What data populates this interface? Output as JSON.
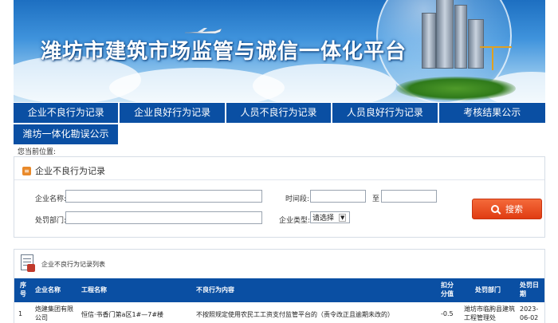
{
  "banner": {
    "title": "潍坊市建筑市场监管与诚信一体化平台"
  },
  "nav": {
    "row1": [
      "企业不良行为记录",
      "企业良好行为记录",
      "人员不良行为记录",
      "人员良好行为记录",
      "考核结果公示"
    ],
    "row2": [
      "潍坊一体化勘误公示"
    ]
  },
  "breadcrumb": "您当前位置:",
  "search_panel": {
    "title": "企业不良行为记录",
    "company_label": "企业名称:",
    "company_value": "",
    "time_label": "时间段:",
    "time_start": "",
    "time_sep": "至",
    "time_end": "",
    "dept_label": "处罚部门:",
    "dept_value": "",
    "type_label": "企业类型:",
    "type_selected": "请选择",
    "search_label": "搜索"
  },
  "results": {
    "title": "企业不良行为记录列表",
    "columns": {
      "seq": "序号",
      "company": "企业名称",
      "project": "工程名称",
      "content": "不良行为内容",
      "score": "扣分分值",
      "dept": "处罚部门",
      "date": "处罚日期"
    },
    "rows": [
      {
        "seq": "1",
        "company": "炮建集团有限公司",
        "project": "恒信·书香门第a区1#—7#楼",
        "content": "不按照规定使用农民工工资支付监管平台的（责令改正且逾期未改的）",
        "score": "-0.5",
        "dept": "潍坊市临朐县建筑工程管理处",
        "date": "2023-06-02"
      }
    ]
  },
  "colors": {
    "nav": "#0a4fa3",
    "search_button": "#e8481c",
    "table_header": "#0a4fa3"
  }
}
